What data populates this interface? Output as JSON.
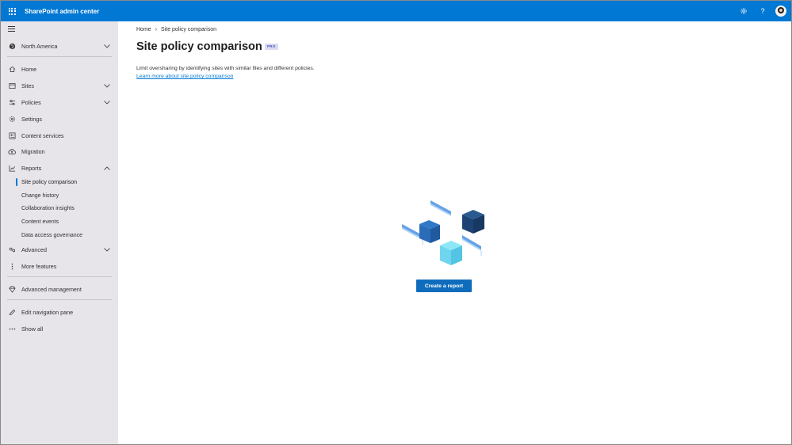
{
  "app": {
    "title": "SharePoint admin center"
  },
  "topbar": {
    "icons": [
      "app-launcher-icon",
      "settings-icon",
      "help-icon",
      "avatar"
    ]
  },
  "sidebar": {
    "region": "North America",
    "items": [
      {
        "label": "Home",
        "icon": "home-icon"
      },
      {
        "label": "Sites",
        "icon": "sites-icon",
        "expandable": true
      },
      {
        "label": "Policies",
        "icon": "policies-icon",
        "expandable": true
      },
      {
        "label": "Settings",
        "icon": "gear-icon"
      },
      {
        "label": "Content services",
        "icon": "content-services-icon"
      },
      {
        "label": "Migration",
        "icon": "cloud-upload-icon"
      },
      {
        "label": "Reports",
        "icon": "chart-icon",
        "expanded": true
      }
    ],
    "reports_children": [
      {
        "label": "Site policy comparison",
        "active": true
      },
      {
        "label": "Change history"
      },
      {
        "label": "Collaboration insights"
      },
      {
        "label": "Content events"
      },
      {
        "label": "Data access governance"
      }
    ],
    "advanced": "Advanced",
    "more_features": "More features",
    "advanced_management": "Advanced management",
    "edit_nav": "Edit navigation pane",
    "show_all": "Show all"
  },
  "breadcrumb": {
    "home": "Home",
    "current": "Site policy comparison"
  },
  "page": {
    "title": "Site policy comparison",
    "badge": "PRO",
    "description": "Limit oversharing by identifying sites with similar files and different policies.",
    "learn_more": "Learn more about site policy comparison",
    "cta": "Create a report"
  },
  "colors": {
    "accent": "#0078d4",
    "sidebar_bg": "#e7e4ea",
    "badge_bg": "#d9dbf3",
    "badge_text": "#4f52b2"
  }
}
